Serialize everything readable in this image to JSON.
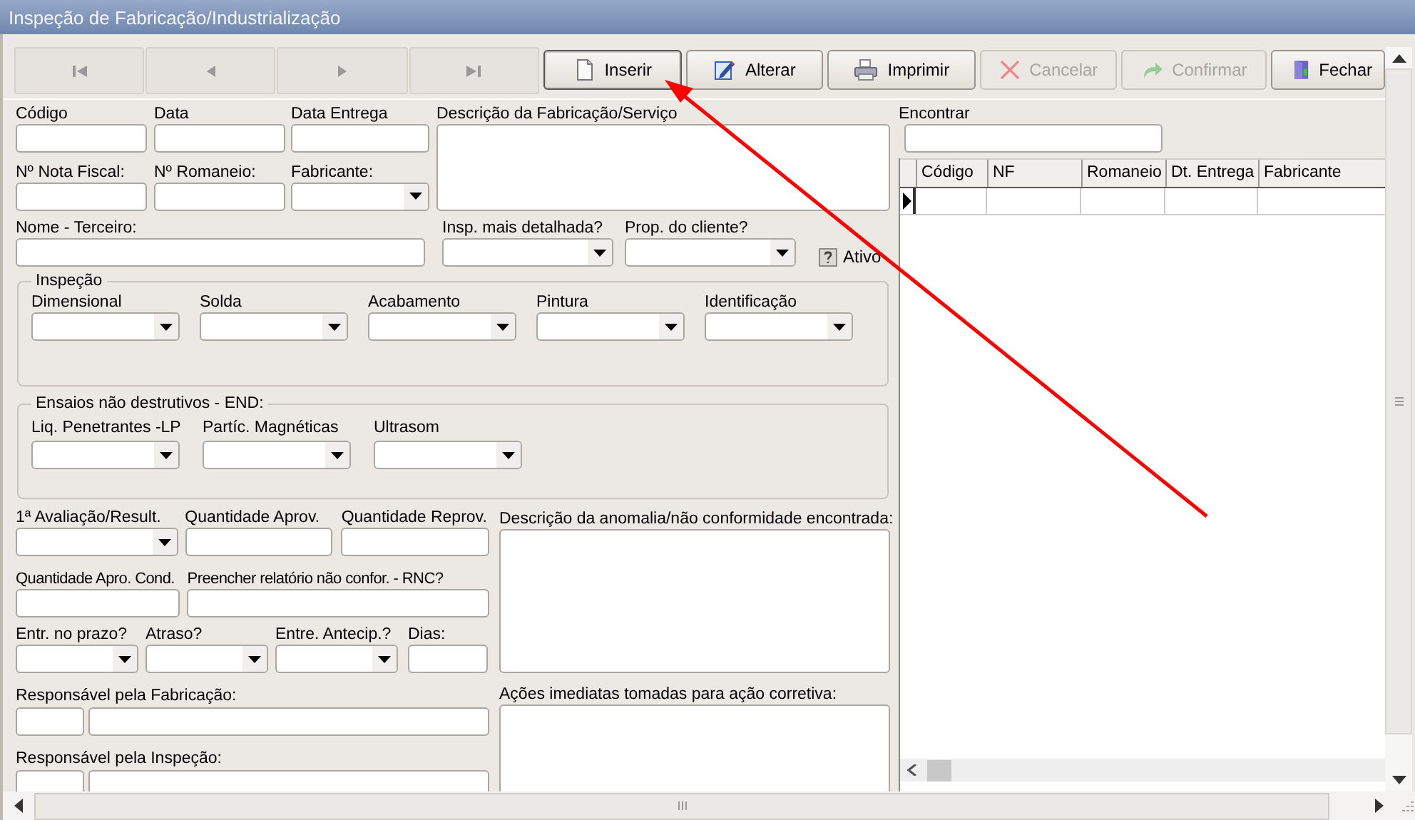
{
  "window": {
    "title": "Inspeção de Fabricação/Industrialização"
  },
  "navigator": [
    {
      "kind": "first",
      "disabled": true
    },
    {
      "kind": "prior",
      "disabled": true
    },
    {
      "kind": "next",
      "disabled": true
    },
    {
      "kind": "last",
      "disabled": true
    }
  ],
  "buttons": [
    {
      "label": "Inserir",
      "kind": "insert",
      "disabled": false,
      "focused": true
    },
    {
      "label": "Alterar",
      "kind": "edit",
      "disabled": false,
      "focused": false
    },
    {
      "label": "Imprimir",
      "kind": "print",
      "disabled": false,
      "focused": false
    },
    {
      "label": "Cancelar",
      "kind": "cancel",
      "disabled": true,
      "focused": false
    },
    {
      "label": "Confirmar",
      "kind": "confirm",
      "disabled": true,
      "focused": false
    },
    {
      "label": "Fechar",
      "kind": "close",
      "disabled": false,
      "focused": false
    }
  ],
  "top_fields": [
    {
      "label": "Código",
      "kind": "text"
    },
    {
      "label": "Data",
      "kind": "text"
    },
    {
      "label": "Data Entrega",
      "kind": "text"
    },
    {
      "label": "Nº Nota Fiscal:",
      "kind": "text"
    },
    {
      "label": "Nº Romaneio:",
      "kind": "text"
    },
    {
      "label": "Fabricante:",
      "kind": "combo"
    }
  ],
  "description": {
    "label": "Descrição da Fabricação/Serviço"
  },
  "third_row": [
    {
      "label": "Nome - Terceiro:",
      "kind": "text"
    },
    {
      "label": "Insp. mais detalhada?",
      "kind": "combo"
    },
    {
      "label": "Prop. do cliente?",
      "kind": "combo"
    }
  ],
  "ativo": {
    "label": "Ativo",
    "grayed": true
  },
  "groups": [
    {
      "title": "Inspeção",
      "fields": [
        {
          "label": "Dimensional"
        },
        {
          "label": "Solda"
        },
        {
          "label": "Acabamento"
        },
        {
          "label": "Pintura"
        },
        {
          "label": "Identificação"
        }
      ]
    },
    {
      "title": "Ensaios não destrutivos - END:",
      "fields": [
        {
          "label": "Liq. Penetrantes -LP"
        },
        {
          "label": "Partíc. Magnéticas"
        },
        {
          "label": "Ultrasom"
        }
      ]
    }
  ],
  "lower_rows": [
    {
      "fields": [
        {
          "label": "1ª Avaliação/Result.",
          "kind": "combo"
        },
        {
          "label": "Quantidade Aprov.",
          "kind": "text"
        },
        {
          "label": "Quantidade Reprov.",
          "kind": "text"
        }
      ]
    },
    {
      "fields": [
        {
          "label": "Quantidade Apro. Cond.",
          "kind": "text"
        },
        {
          "label": "Preencher relatório não confor. - RNC?",
          "kind": "text"
        }
      ]
    },
    {
      "fields": [
        {
          "label": "Entr. no prazo?",
          "kind": "combo"
        },
        {
          "label": "Atraso?",
          "kind": "combo"
        },
        {
          "label": "Entre. Antecip.?",
          "kind": "combo"
        },
        {
          "label": "Dias:",
          "kind": "text"
        }
      ]
    }
  ],
  "responsibles": [
    {
      "label": "Responsável pela Fabricação:"
    },
    {
      "label": "Responsável pela Inspeção:"
    }
  ],
  "notes": [
    {
      "label": "Descrição da anomalia/não conformidade encontrada:"
    },
    {
      "label": "Ações imediatas tomadas para ação corretiva:"
    }
  ],
  "search": {
    "label": "Encontrar"
  },
  "grid": {
    "columns": [
      "Código",
      "NF",
      "Romaneio",
      "Dt. Entrega",
      "Fabricante"
    ],
    "rows": [
      {
        "selected": true
      }
    ]
  },
  "annotation": {
    "kind": "arrow"
  }
}
